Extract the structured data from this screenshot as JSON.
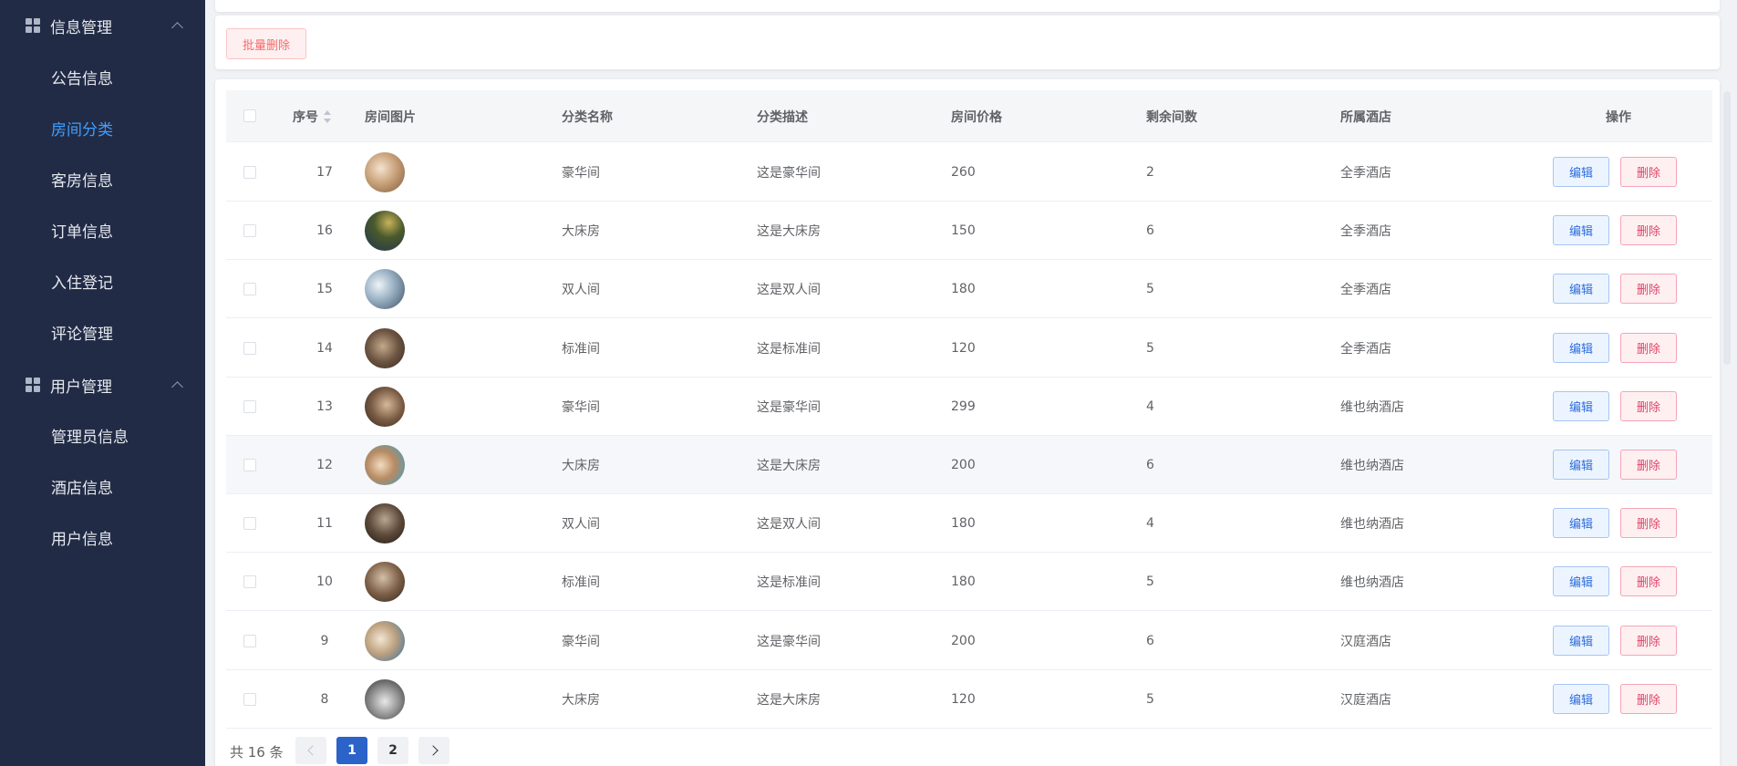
{
  "sidebar": {
    "group1": {
      "title": "信息管理",
      "icon": "grid-icon"
    },
    "items1": [
      {
        "label": "公告信息"
      },
      {
        "label": "房间分类",
        "active": true
      },
      {
        "label": "客房信息"
      },
      {
        "label": "订单信息"
      },
      {
        "label": "入住登记"
      },
      {
        "label": "评论管理"
      }
    ],
    "group2": {
      "title": "用户管理",
      "icon": "grid-icon"
    },
    "items2": [
      {
        "label": "管理员信息"
      },
      {
        "label": "酒店信息"
      },
      {
        "label": "用户信息"
      }
    ]
  },
  "toolbar": {
    "batch_delete": "批量删除"
  },
  "table": {
    "columns": {
      "index": "序号",
      "image": "房间图片",
      "name": "分类名称",
      "desc": "分类描述",
      "price": "房间价格",
      "remaining": "剩余间数",
      "hotel": "所属酒店",
      "actions": "操作"
    },
    "rows": [
      {
        "index": "17",
        "name": "豪华间",
        "desc": "这是豪华间",
        "price": "260",
        "remaining": "2",
        "hotel": "全季酒店"
      },
      {
        "index": "16",
        "name": "大床房",
        "desc": "这是大床房",
        "price": "150",
        "remaining": "6",
        "hotel": "全季酒店"
      },
      {
        "index": "15",
        "name": "双人间",
        "desc": "这是双人间",
        "price": "180",
        "remaining": "5",
        "hotel": "全季酒店"
      },
      {
        "index": "14",
        "name": "标准间",
        "desc": "这是标准间",
        "price": "120",
        "remaining": "5",
        "hotel": "全季酒店"
      },
      {
        "index": "13",
        "name": "豪华间",
        "desc": "这是豪华间",
        "price": "299",
        "remaining": "4",
        "hotel": "维也纳酒店"
      },
      {
        "index": "12",
        "name": "大床房",
        "desc": "这是大床房",
        "price": "200",
        "remaining": "6",
        "hotel": "维也纳酒店"
      },
      {
        "index": "11",
        "name": "双人间",
        "desc": "这是双人间",
        "price": "180",
        "remaining": "4",
        "hotel": "维也纳酒店"
      },
      {
        "index": "10",
        "name": "标准间",
        "desc": "这是标准间",
        "price": "180",
        "remaining": "5",
        "hotel": "维也纳酒店"
      },
      {
        "index": "9",
        "name": "豪华间",
        "desc": "这是豪华间",
        "price": "200",
        "remaining": "6",
        "hotel": "汉庭酒店"
      },
      {
        "index": "8",
        "name": "大床房",
        "desc": "这是大床房",
        "price": "120",
        "remaining": "5",
        "hotel": "汉庭酒店"
      }
    ],
    "edit_label": "编辑",
    "delete_label": "删除"
  },
  "pagination": {
    "total": "共 16 条",
    "pages": [
      "1",
      "2"
    ],
    "current": "1"
  },
  "colors": {
    "sidebar_bg": "#222b45",
    "accent": "#409eff",
    "danger": "#f56c6c",
    "page_active": "#2b63c9"
  }
}
